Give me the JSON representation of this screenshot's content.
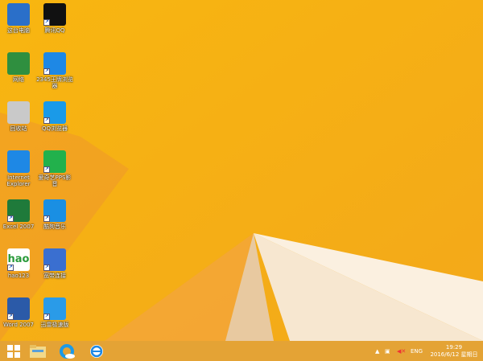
{
  "desktop": {
    "icons": [
      {
        "label": "这台电脑",
        "icon": "computer-icon",
        "color": "#2a6fc9"
      },
      {
        "label": "腾讯QQ",
        "icon": "qq-penguin-icon",
        "color": "#111111"
      },
      {
        "label": "网络",
        "icon": "network-globe-icon",
        "color": "#2f8f3f"
      },
      {
        "label": "2345王牌浏览器",
        "icon": "browser-2345-icon",
        "color": "#1e88e5"
      },
      {
        "label": "回收站",
        "icon": "recycle-bin-icon",
        "color": "#c9c9c9"
      },
      {
        "label": "QQ浏览器",
        "icon": "qq-browser-icon",
        "color": "#1a9ae8"
      },
      {
        "label": "Internet Explorer",
        "icon": "internet-explorer-icon",
        "color": "#1e88e5"
      },
      {
        "label": "爱奇艺PPS影音",
        "icon": "iqiyi-icon",
        "color": "#22b14c"
      },
      {
        "label": "Excel 2007",
        "icon": "excel-icon",
        "color": "#1f7a3a"
      },
      {
        "label": "酷狗音乐",
        "icon": "kugou-icon",
        "color": "#1a8fe3"
      },
      {
        "label": "hao123",
        "icon": "hao123-icon",
        "color": "#ffffff"
      },
      {
        "label": "宽带连接",
        "icon": "broadband-connection-icon",
        "color": "#3a6fd0"
      },
      {
        "label": "Word 2007",
        "icon": "word-icon",
        "color": "#2b5aa8"
      },
      {
        "label": "迅雷极速版",
        "icon": "xunlei-icon",
        "color": "#2a9be8"
      }
    ]
  },
  "taskbar": {
    "lang": "ENG",
    "time": "19:29",
    "date": "2016/6/12 星期日"
  }
}
